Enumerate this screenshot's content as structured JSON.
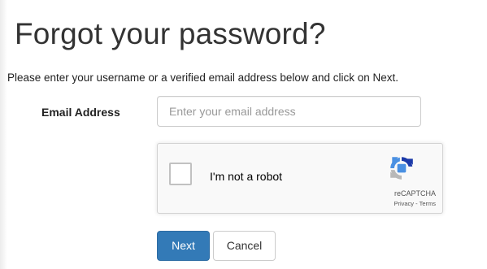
{
  "page": {
    "title": "Forgot your password?",
    "instructions": "Please enter your username or a verified email address below and click on Next."
  },
  "form": {
    "email_label": "Email Address",
    "email_value": "",
    "email_placeholder": "Enter your email address"
  },
  "recaptcha": {
    "checkbox_label": "I'm not a robot",
    "brand": "reCAPTCHA",
    "privacy_link": "Privacy",
    "separator": "-",
    "terms_link": "Terms",
    "logo_icon": "recaptcha-logo-icon",
    "colors": {
      "logo_blue": "#4a90e2",
      "logo_dark_blue": "#1c3aa9",
      "logo_gray": "#b8b8b8"
    }
  },
  "actions": {
    "next_label": "Next",
    "cancel_label": "Cancel"
  },
  "colors": {
    "primary": "#337ab7",
    "text": "#333333"
  }
}
